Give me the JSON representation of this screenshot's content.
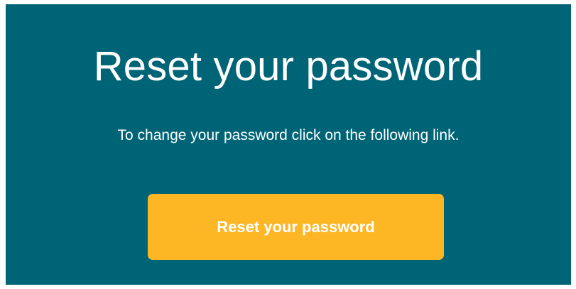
{
  "email": {
    "title": "Reset your password",
    "message": "To change your password click on the following link.",
    "button_label": "Reset your password"
  },
  "colors": {
    "background": "#006477",
    "button": "#fdb624",
    "text": "#ffffff"
  }
}
